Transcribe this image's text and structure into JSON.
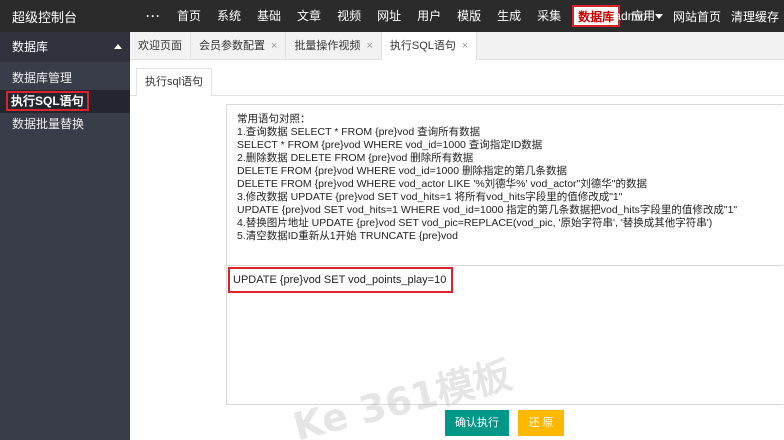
{
  "topbar": {
    "brand": "超级控制台",
    "more": "···",
    "nav": [
      "首页",
      "系统",
      "基础",
      "文章",
      "视频",
      "网址",
      "用户",
      "模版",
      "生成",
      "采集",
      "数据库",
      "应用"
    ],
    "active": "数据库",
    "user": "admin",
    "site_home": "网站首页",
    "clear_cache": "清理缓存"
  },
  "sidebar": {
    "title": "数据库",
    "items": [
      "数据库管理",
      "执行SQL语句",
      "数据批量替换"
    ]
  },
  "tabs": [
    {
      "label": "欢迎页面"
    },
    {
      "label": "会员参数配置"
    },
    {
      "label": "批量操作视频"
    },
    {
      "label": "执行SQL语句"
    }
  ],
  "tab_close": "×",
  "subtab": "执行sql语句",
  "description_lines": [
    "常用语句对照：",
    "1.查询数据 SELECT * FROM {pre}vod 查询所有数据",
    "SELECT * FROM {pre}vod WHERE vod_id=1000 查询指定ID数据",
    "2.删除数据 DELETE FROM {pre}vod 删除所有数据",
    "DELETE FROM {pre}vod WHERE vod_id=1000 删除指定的第几条数据",
    "DELETE FROM {pre}vod WHERE vod_actor LIKE '%刘德华%' vod_actor\"刘德华\"的数据",
    "3.修改数据 UPDATE {pre}vod SET vod_hits=1 将所有vod_hits字段里的值修改成\"1\"",
    "UPDATE {pre}vod SET vod_hits=1 WHERE vod_id=1000 指定的第几条数据把vod_hits字段里的值修改成\"1\"",
    "4.替换图片地址 UPDATE {pre}vod SET vod_pic=REPLACE(vod_pic, '原始字符串', '替换成其他字符串')",
    "5.清空数据ID重新从1开始 TRUNCATE {pre}vod"
  ],
  "sql_value": "UPDATE {pre}vod SET vod_points_play=10",
  "buttons": {
    "confirm": "确认执行",
    "reset": "还 原"
  },
  "watermark": "Ke 361模板"
}
